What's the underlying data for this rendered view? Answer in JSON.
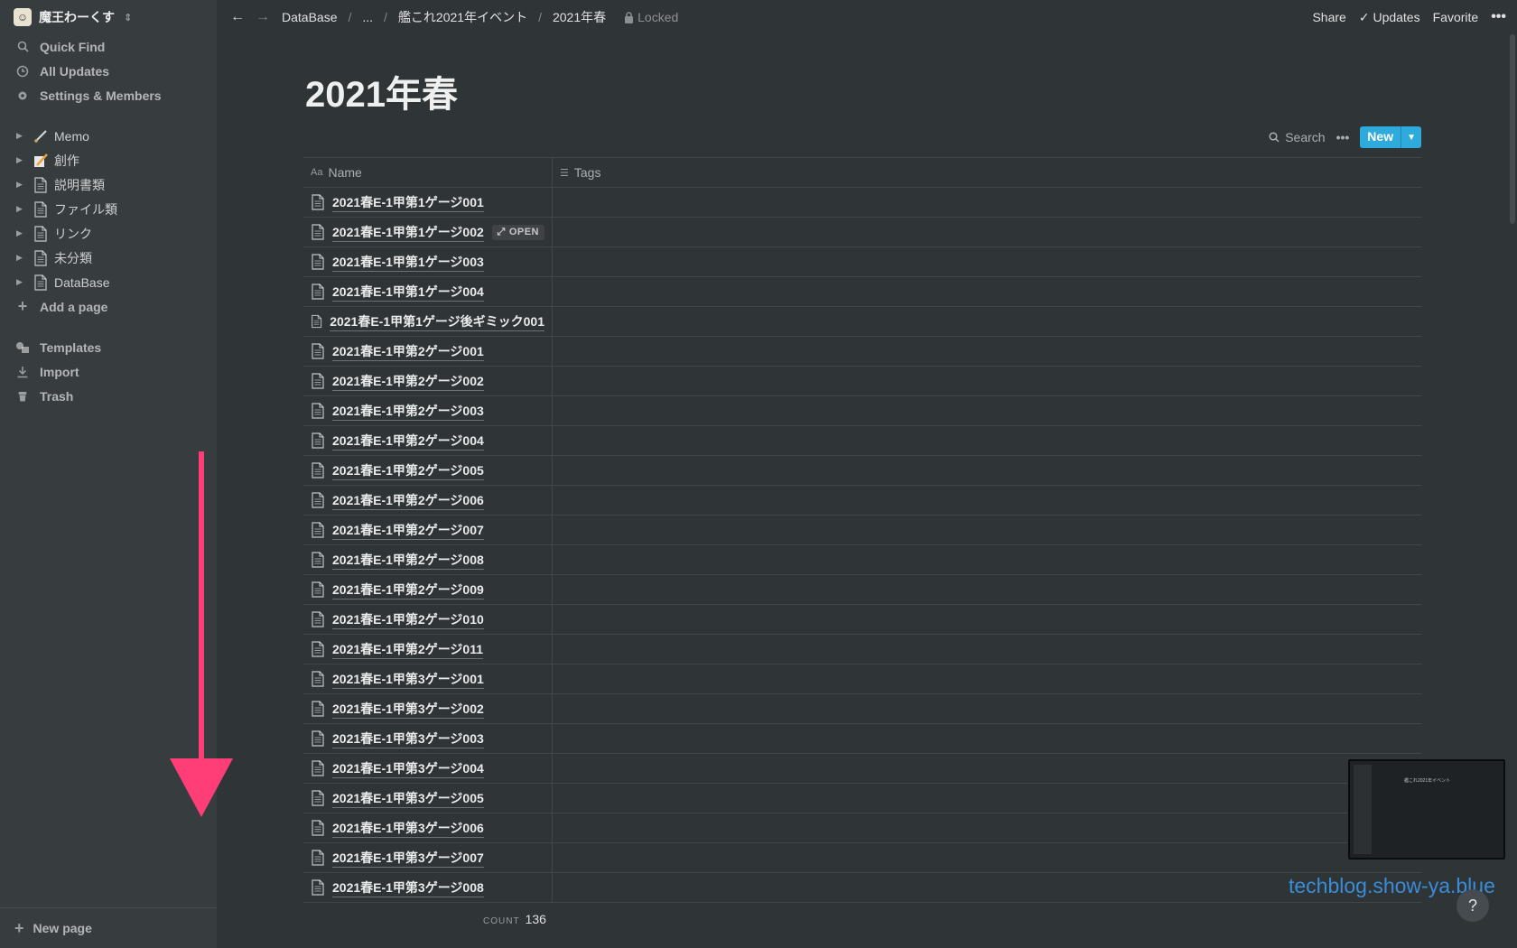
{
  "workspace": {
    "name": "魔王わーくす"
  },
  "sidebar": {
    "top_items": [
      {
        "icon": "search-icon",
        "label": "Quick Find"
      },
      {
        "icon": "clock-icon",
        "label": "All Updates"
      },
      {
        "icon": "gear-icon",
        "label": "Settings & Members"
      }
    ],
    "pages": [
      {
        "icon": "brush-icon",
        "label": "Memo"
      },
      {
        "icon": "pencil-paper-icon",
        "label": "創作"
      },
      {
        "icon": "document-icon",
        "label": "説明書類"
      },
      {
        "icon": "document-icon",
        "label": "ファイル類"
      },
      {
        "icon": "document-icon",
        "label": "リンク"
      },
      {
        "icon": "document-icon",
        "label": "未分類"
      },
      {
        "icon": "document-icon",
        "label": "DataBase"
      }
    ],
    "add_page": "Add a page",
    "bottom_items": [
      {
        "icon": "templates-icon",
        "label": "Templates"
      },
      {
        "icon": "import-icon",
        "label": "Import"
      },
      {
        "icon": "trash-icon",
        "label": "Trash"
      }
    ],
    "new_page": "New page",
    "annotation_arrow_color": "#ff3d77"
  },
  "topbar": {
    "breadcrumbs": [
      "DataBase",
      "...",
      "艦これ2021年イベント",
      "2021年春"
    ],
    "locked": "Locked",
    "share": "Share",
    "updates": "Updates",
    "favorite": "Favorite"
  },
  "page": {
    "title": "2021年春",
    "search": "Search",
    "new_button": "New",
    "accent": "#2eaadc"
  },
  "table": {
    "columns": [
      {
        "icon": "Aa",
        "label": "Name"
      },
      {
        "icon": "list-icon",
        "label": "Tags"
      }
    ],
    "hover_row_index": 1,
    "open_label": "OPEN",
    "rows": [
      "2021春E-1甲第1ゲージ001",
      "2021春E-1甲第1ゲージ002",
      "2021春E-1甲第1ゲージ003",
      "2021春E-1甲第1ゲージ004",
      "2021春E-1甲第1ゲージ後ギミック001",
      "2021春E-1甲第2ゲージ001",
      "2021春E-1甲第2ゲージ002",
      "2021春E-1甲第2ゲージ003",
      "2021春E-1甲第2ゲージ004",
      "2021春E-1甲第2ゲージ005",
      "2021春E-1甲第2ゲージ006",
      "2021春E-1甲第2ゲージ007",
      "2021春E-1甲第2ゲージ008",
      "2021春E-1甲第2ゲージ009",
      "2021春E-1甲第2ゲージ010",
      "2021春E-1甲第2ゲージ011",
      "2021春E-1甲第3ゲージ001",
      "2021春E-1甲第3ゲージ002",
      "2021春E-1甲第3ゲージ003",
      "2021春E-1甲第3ゲージ004",
      "2021春E-1甲第3ゲージ005",
      "2021春E-1甲第3ゲージ006",
      "2021春E-1甲第3ゲージ007",
      "2021春E-1甲第3ゲージ008"
    ],
    "count_label": "COUNT",
    "count_value": "136"
  },
  "minimap": {
    "title": "艦これ2021年イベント"
  },
  "watermark": "techblog.show-ya.blue",
  "help": "?"
}
